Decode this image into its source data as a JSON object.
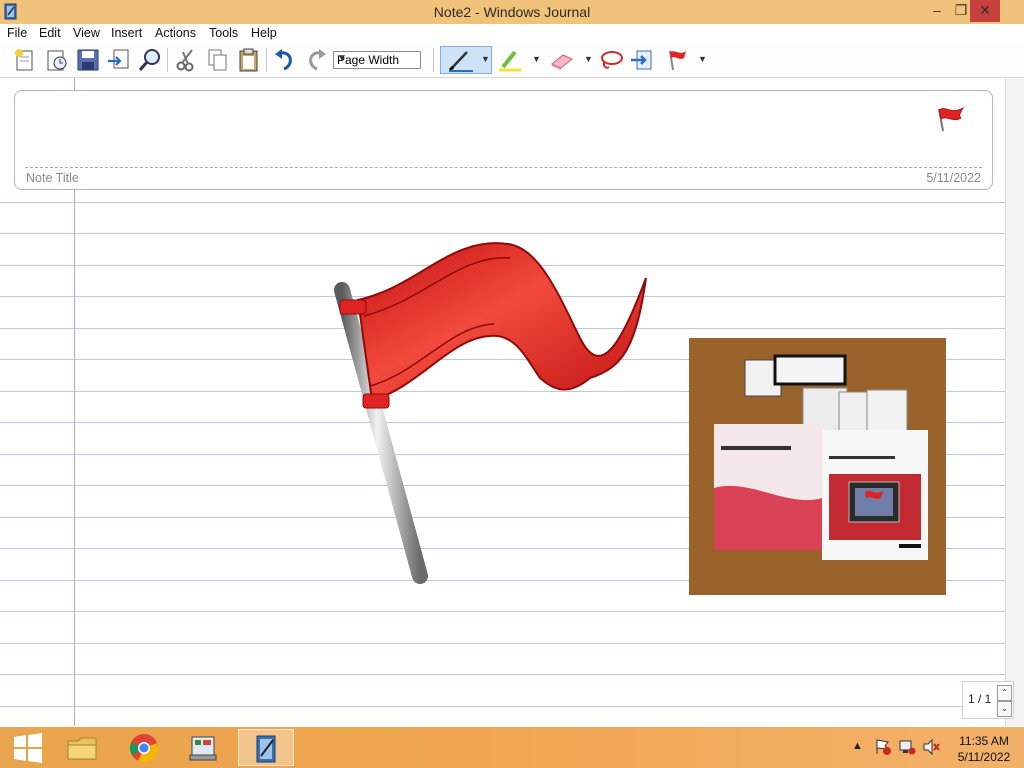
{
  "window": {
    "title": "Note2 - Windows Journal"
  },
  "window_buttons": {
    "min": "–",
    "max": "❐",
    "close": "✕"
  },
  "menu": [
    "File",
    "Edit",
    "View",
    "Insert",
    "Actions",
    "Tools",
    "Help"
  ],
  "toolbar": {
    "zoom_value": "Page Width"
  },
  "note": {
    "title_placeholder": "Note Title",
    "date": "5/11/2022"
  },
  "pager": {
    "text": "1 / 1"
  },
  "taskbar": {
    "time": "11:35 AM",
    "date": "5/11/2022"
  },
  "colors": {
    "titlebar": "#f1c27a",
    "taskbar": "#f0a650",
    "flag_red": "#e02424",
    "ruled_line": "#bccae0",
    "margin_line": "#c9a0b4"
  }
}
